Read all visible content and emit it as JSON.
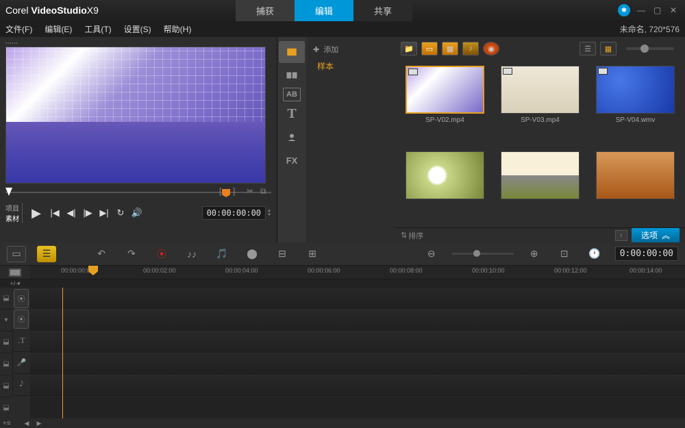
{
  "app": {
    "name_a": "Corel",
    "name_b": "VideoStudio",
    "name_c": "X9"
  },
  "titlebar_tabs": {
    "capture": "捕获",
    "edit": "编辑",
    "share": "共享"
  },
  "menu": {
    "file": "文件(F)",
    "edit": "编辑(E)",
    "tools": "工具(T)",
    "settings": "设置(S)",
    "help": "帮助(H)"
  },
  "project_info": "未命名, 720*576",
  "preview": {
    "mode_project": "项目",
    "mode_clip": "素材",
    "timecode": "00:00:00:00"
  },
  "library": {
    "add": "添加",
    "folder": "样本",
    "sort": "排序",
    "options": "选项",
    "clips": [
      {
        "name": "SP-V02.mp4"
      },
      {
        "name": "SP-V03.mp4"
      },
      {
        "name": "SP-V04.wmv"
      },
      {
        "name": ""
      },
      {
        "name": ""
      },
      {
        "name": ""
      }
    ]
  },
  "timeline": {
    "timecode": "0:00:00:00",
    "ruler": [
      "00:00:00:00",
      "00:00:02:00",
      "00:00:04:00",
      "00:00:06:00",
      "00:00:08:00",
      "00:00:10:00",
      "00:00:12:00",
      "00:00:14:00"
    ],
    "ruler_sub": "+/-▾"
  }
}
